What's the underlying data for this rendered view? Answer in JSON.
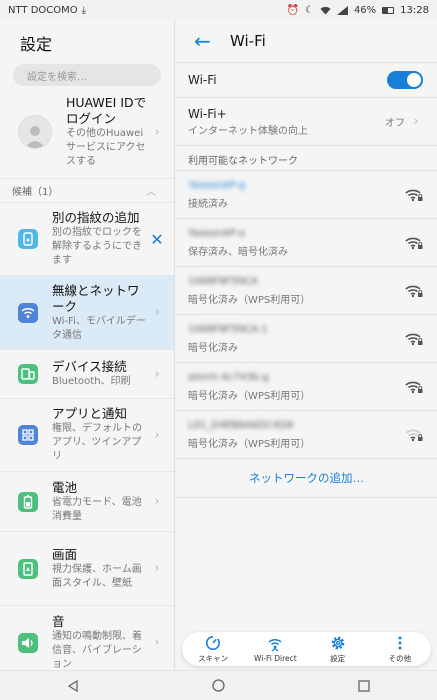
{
  "status_bar": {
    "carrier": "NTT DOCOMO",
    "battery": "46%",
    "time": "13:28"
  },
  "left_pane": {
    "title": "設定",
    "search_placeholder": "設定を検索…",
    "huawei_id": {
      "title": "HUAWEI IDでログイン",
      "subtitle": "その他のHuaweiサービスにアクセスする"
    },
    "section": {
      "label": "候補（1）"
    },
    "items": [
      {
        "title": "別の指紋の追加",
        "subtitle": "別の指紋でロックを解除するようにできます"
      },
      {
        "title": "無線とネットワーク",
        "subtitle": "Wi-Fi、モバイルデータ通信"
      },
      {
        "title": "デバイス接続",
        "subtitle": "Bluetooth、印刷"
      },
      {
        "title": "アプリと通知",
        "subtitle": "権限、デフォルトのアプリ、ツインアプリ"
      },
      {
        "title": "電池",
        "subtitle": "省電力モード、電池消費量"
      },
      {
        "title": "画面",
        "subtitle": "視力保護、ホーム画面スタイル、壁紙"
      },
      {
        "title": "音",
        "subtitle": "通知の鳴動制限、着信音、バイブレーション"
      }
    ]
  },
  "right_pane": {
    "title": "Wi-Fi",
    "wifi_toggle_label": "Wi-Fi",
    "wifi_plus": {
      "title": "Wi-Fi+",
      "subtitle": "インターネット体験の向上",
      "value": "オフ"
    },
    "networks_header": "利用可能なネットワーク",
    "networks": [
      {
        "ssid": "YaasanAP-g",
        "status": "接続済み"
      },
      {
        "ssid": "YaasanAP-a",
        "status": "保存済み、暗号化済み"
      },
      {
        "ssid": "1068F8F59CA",
        "status": "暗号化済み（WPS利用可）"
      },
      {
        "ssid": "1068F8F59CA-1",
        "status": "暗号化済み"
      },
      {
        "ssid": "aterm-4c743b-g",
        "status": "暗号化済み（WPS利用可）"
      },
      {
        "ssid": "L01_D4EB6A6DC4D8",
        "status": "暗号化済み（WPS利用可）"
      }
    ],
    "add_network": "ネットワークの追加…",
    "toolbar": {
      "scan": "スキャン",
      "wifi_direct": "Wi-Fi Direct",
      "settings": "設定",
      "more": "その他"
    }
  },
  "colors": {
    "accent": "#1a7ed6"
  }
}
